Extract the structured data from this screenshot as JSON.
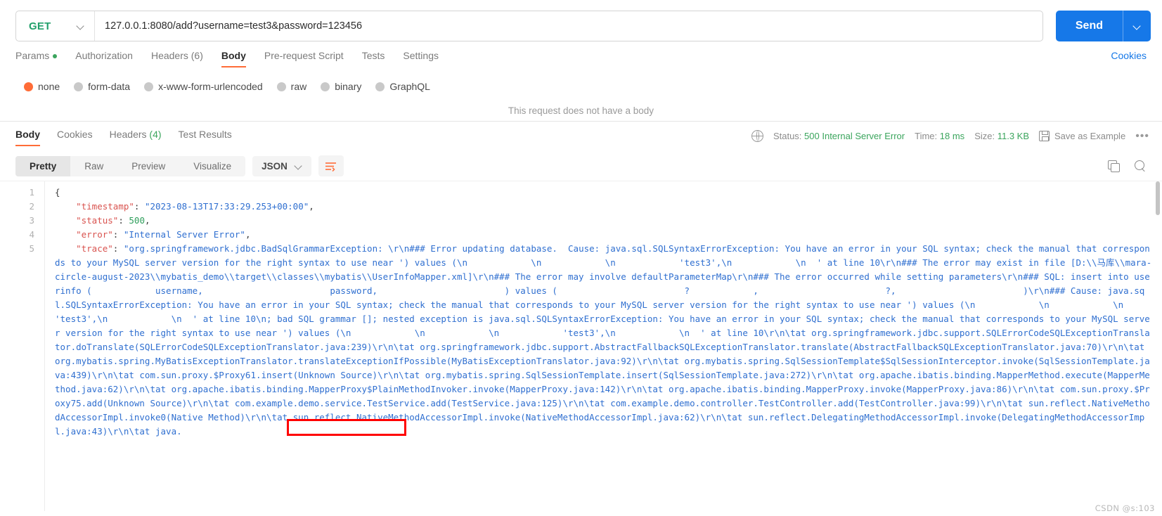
{
  "request": {
    "method": "GET",
    "url": "127.0.0.1:8080/add?username=test3&password=123456",
    "send_label": "Send",
    "cookies_label": "Cookies",
    "tabs": [
      {
        "label": "Params",
        "badge": "dot",
        "active": false
      },
      {
        "label": "Authorization",
        "badge": "",
        "active": false
      },
      {
        "label": "Headers (6)",
        "badge": "",
        "active": false
      },
      {
        "label": "Body",
        "badge": "",
        "active": true
      },
      {
        "label": "Pre-request Script",
        "badge": "",
        "active": false
      },
      {
        "label": "Tests",
        "badge": "",
        "active": false
      },
      {
        "label": "Settings",
        "badge": "",
        "active": false
      }
    ],
    "body_types": [
      {
        "label": "none",
        "selected": true
      },
      {
        "label": "form-data",
        "selected": false
      },
      {
        "label": "x-www-form-urlencoded",
        "selected": false
      },
      {
        "label": "raw",
        "selected": false
      },
      {
        "label": "binary",
        "selected": false
      },
      {
        "label": "GraphQL",
        "selected": false
      }
    ],
    "no_body_note": "This request does not have a body"
  },
  "response": {
    "tabs": [
      {
        "label": "Body",
        "active": true
      },
      {
        "label": "Cookies",
        "active": false
      },
      {
        "label": "Headers (4)",
        "active": false
      },
      {
        "label": "Test Results",
        "active": false
      }
    ],
    "headers_tab_text": "Headers",
    "headers_tab_count": "(4)",
    "status_label": "Status:",
    "status_value": "500 Internal Server Error",
    "time_label": "Time:",
    "time_value": "18 ms",
    "size_label": "Size:",
    "size_value": "11.3 KB",
    "save_example_label": "Save as Example",
    "more_label": "•••",
    "format_tabs": [
      {
        "label": "Pretty",
        "active": true
      },
      {
        "label": "Raw",
        "active": false
      },
      {
        "label": "Preview",
        "active": false
      },
      {
        "label": "Visualize",
        "active": false
      }
    ],
    "language": "JSON",
    "line_numbers": [
      "1",
      "2",
      "3",
      "4",
      "5"
    ],
    "json": {
      "open_brace": "{",
      "timestamp_key": "\"timestamp\"",
      "timestamp_value": "\"2023-08-13T17:33:29.253+00:00\"",
      "status_key": "\"status\"",
      "status_value": "500",
      "error_key": "\"error\"",
      "error_value": "\"Internal Server Error\"",
      "trace_key": "\"trace\"",
      "trace_value": "\"org.springframework.jdbc.BadSqlGrammarException: \\r\\n### Error updating database.  Cause: java.sql.SQLSyntaxErrorException: You have an error in your SQL syntax; check the manual that corresponds to your MySQL server version for the right syntax to use near ') values (\\n            \\n            \\n            'test3',\\n            \\n  ' at line 10\\r\\n### The error may exist in file [D:\\\\马库\\\\mara-circle-august-2023\\\\mybatis_demo\\\\target\\\\classes\\\\mybatis\\\\UserInfoMapper.xml]\\r\\n### The error may involve defaultParameterMap\\r\\n### The error occurred while setting parameters\\r\\n### SQL: insert into userinfo (            username,                        password,                        ) values (                        ?            ,                        ?,                        )\\r\\n### Cause: java.sql.SQLSyntaxErrorException: You have an error in your SQL syntax; check the manual that corresponds to your MySQL server version for the right syntax to use near ') values (\\n            \\n            \\n            'test3',\\n            \\n  ' at line 10\\n; bad SQL grammar []; nested exception is java.sql.SQLSyntaxErrorException: You have an error in your SQL syntax; check the manual that corresponds to your MySQL server version for the right syntax to use near ') values (\\n            \\n            \\n            'test3',\\n            \\n  ' at line 10\\r\\n\\tat org.springframework.jdbc.support.SQLErrorCodeSQLExceptionTranslator.doTranslate(SQLErrorCodeSQLExceptionTranslator.java:239)\\r\\n\\tat org.springframework.jdbc.support.AbstractFallbackSQLExceptionTranslator.translate(AbstractFallbackSQLExceptionTranslator.java:70)\\r\\n\\tat org.mybatis.spring.MyBatisExceptionTranslator.translateExceptionIfPossible(MyBatisExceptionTranslator.java:92)\\r\\n\\tat org.mybatis.spring.SqlSessionTemplate$SqlSessionInterceptor.invoke(SqlSessionTemplate.java:439)\\r\\n\\tat com.sun.proxy.$Proxy61.insert(Unknown Source)\\r\\n\\tat org.mybatis.spring.SqlSessionTemplate.insert(SqlSessionTemplate.java:272)\\r\\n\\tat org.apache.ibatis.binding.MapperMethod.execute(MapperMethod.java:62)\\r\\n\\tat org.apache.ibatis.binding.MapperProxy$PlainMethodInvoker.invoke(MapperProxy.java:142)\\r\\n\\tat org.apache.ibatis.binding.MapperProxy.invoke(MapperProxy.java:86)\\r\\n\\tat com.sun.proxy.$Proxy75.add(Unknown Source)\\r\\n\\tat com.example.demo.service.TestService.add(TestService.java:125)\\r\\n\\tat com.example.demo.controller.TestController.add(TestController.java:99)\\r\\n\\tat sun.reflect.NativeMethodAccessorImpl.invoke0(Native Method)\\r\\n\\tat sun.reflect.NativeMethodAccessorImpl.invoke(NativeMethodAccessorImpl.java:62)\\r\\n\\tat sun.reflect.DelegatingMethodAccessorImpl.invoke(DelegatingMethodAccessorImpl.java:43)\\r\\n\\tat java."
    },
    "highlight_annotation": "BadSqlGrammarException:"
  },
  "watermark": "CSDN @s:103",
  "colors": {
    "accent_orange": "#ff6c37",
    "send_blue": "#1678e8",
    "status_green": "#3ba55d",
    "method_green": "#22a06b",
    "highlight_red": "#ff0000"
  }
}
